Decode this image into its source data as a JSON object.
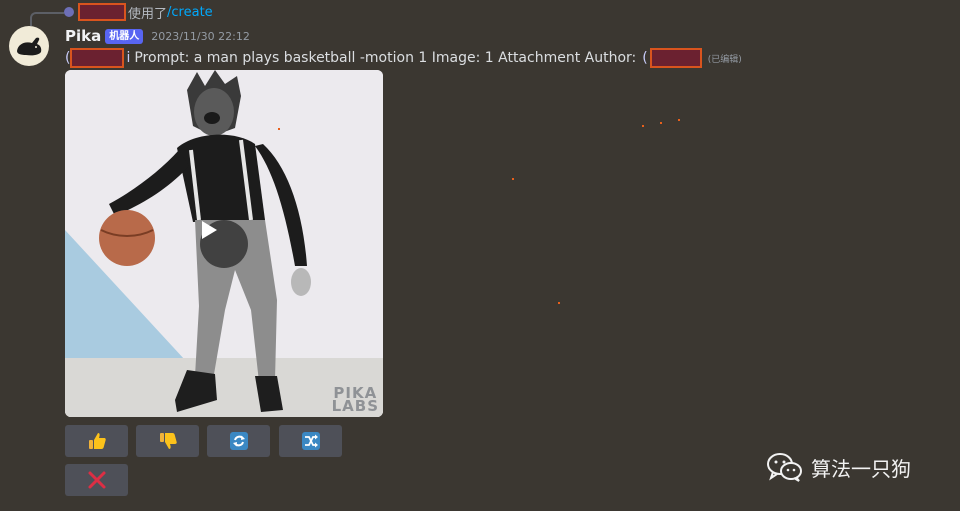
{
  "reply": {
    "text": "使用了",
    "command": "/create"
  },
  "message": {
    "username": "Pika",
    "bot_tag": "机器人",
    "timestamp": "2023/11/30 22:12",
    "mention_prefix_left": "(",
    "mention_suffix_left": "i",
    "body": "Prompt: a man plays basketball -motion 1  Image: 1 Attachment  Author:",
    "mention_prefix_right": "(",
    "edited": "(已编辑)"
  },
  "media": {
    "watermark_line1": "PIKA",
    "watermark_line2": "LABS"
  },
  "buttons": [
    {
      "name": "thumbs-up-button",
      "icon": "thumbs-up-icon"
    },
    {
      "name": "thumbs-down-button",
      "icon": "thumbs-down-icon"
    },
    {
      "name": "retry-button",
      "icon": "repeat-icon"
    },
    {
      "name": "shuffle-button",
      "icon": "shuffle-icon"
    },
    {
      "name": "delete-button",
      "icon": "cross-mark-icon"
    }
  ],
  "overlay": {
    "wechat_label": "算法一只狗"
  },
  "colors": {
    "background": "#3b3731",
    "bot_tag": "#5865f2",
    "command_link": "#00a8fc",
    "button": "#4e5058",
    "redaction": "#6b2130"
  }
}
